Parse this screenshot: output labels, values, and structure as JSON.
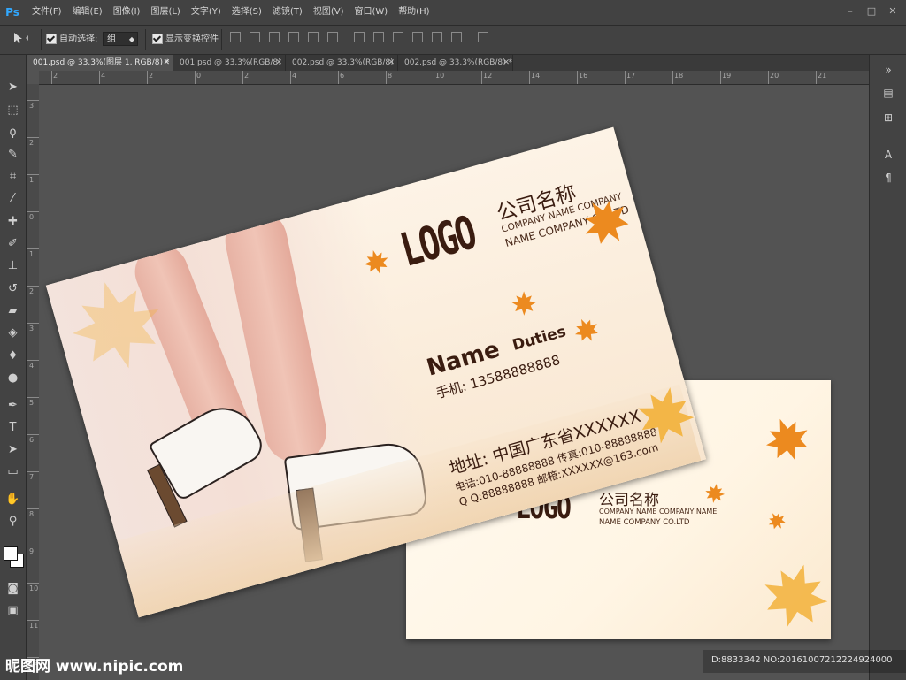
{
  "app": {
    "logo_text": "Ps"
  },
  "menu": [
    "文件(F)",
    "编辑(E)",
    "图像(I)",
    "图层(L)",
    "文字(Y)",
    "选择(S)",
    "滤镜(T)",
    "视图(V)",
    "窗口(W)",
    "帮助(H)"
  ],
  "window_controls": [
    "–",
    "□",
    "✕"
  ],
  "options": {
    "auto_select_label": "自动选择:",
    "auto_select_value": "组",
    "show_transform_label": "显示变换控件"
  },
  "tabs": [
    {
      "label": "001.psd @ 33.3%(图层 1, RGB/8) *",
      "close": "✕"
    },
    {
      "label": "001.psd @ 33.3%(RGB/8)",
      "close": "✕"
    },
    {
      "label": "002.psd @ 33.3%(RGB/8)",
      "close": "✕"
    },
    {
      "label": "002.psd @ 33.3%(RGB/8) *",
      "close": "✕"
    }
  ],
  "ruler_top": [
    "2",
    "4",
    "2",
    "0",
    "2",
    "4",
    "6",
    "8",
    "10",
    "12",
    "14",
    "16",
    "17",
    "18",
    "19",
    "20",
    "21"
  ],
  "ruler_left": [
    "3",
    "2",
    "1",
    "0",
    "1",
    "2",
    "3",
    "4",
    "5",
    "6",
    "7",
    "8",
    "9",
    "10",
    "11",
    "12"
  ],
  "front_card": {
    "logo": "LOGO",
    "company_cn": "公司名称",
    "company_en1": "COMPANY NAME COMPANY",
    "company_en2": "NAME COMPANY CO.LTD",
    "name": "Name",
    "duties": "Duties",
    "mobile": "手机:  13588888888",
    "address": "地址:  中国广东省XXXXXX",
    "tel_fax": "电话:010-88888888  传真:010-88888888",
    "qq_mail": "Q Q:88888888  邮箱:XXXXXX@163.com"
  },
  "back_card": {
    "logo": "LOGO",
    "company_cn": "公司名称",
    "company_en1": "COMPANY NAME COMPANY NAME",
    "company_en2": "NAME COMPANY CO.LTD"
  },
  "watermark": {
    "site": "昵图网 www.nipic.com",
    "id": "ID:8833342 NO:20161007212224924000"
  },
  "colors": {
    "leaf": "#e88a1a",
    "text_dark": "#3a1c10"
  }
}
